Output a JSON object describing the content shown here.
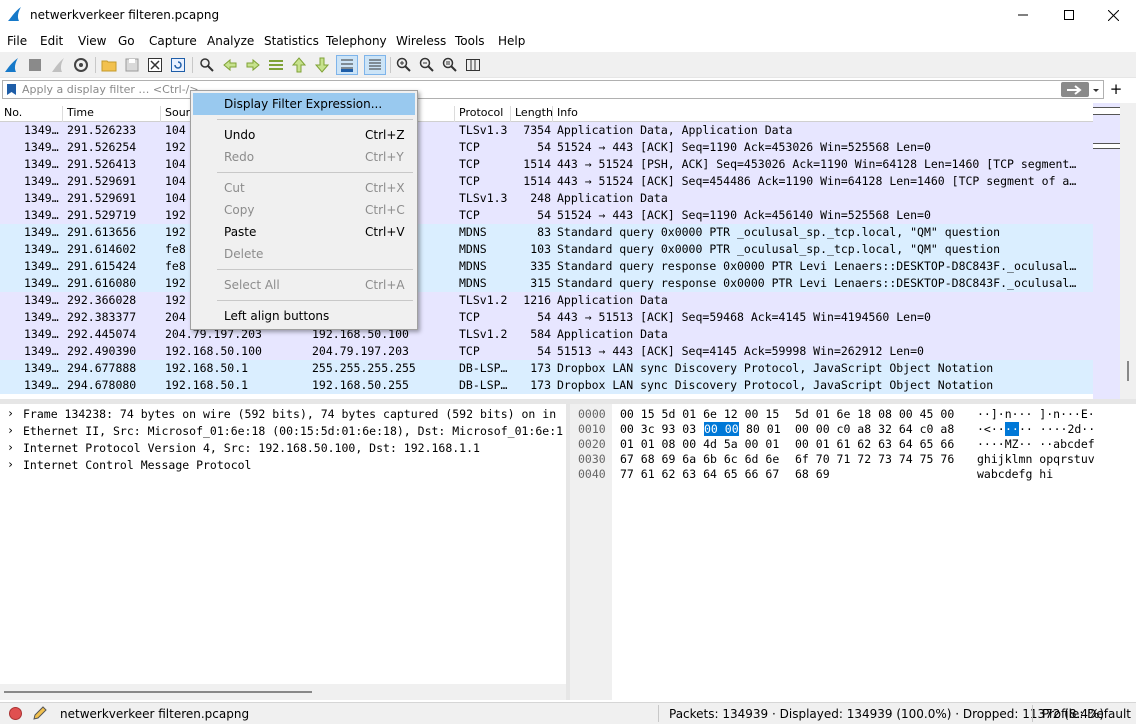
{
  "window": {
    "title": "netwerkverkeer filteren.pcapng"
  },
  "menu": [
    "File",
    "Edit",
    "View",
    "Go",
    "Capture",
    "Analyze",
    "Statistics",
    "Telephony",
    "Wireless",
    "Tools",
    "Help"
  ],
  "filter": {
    "placeholder": "Apply a display filter … <Ctrl-/>"
  },
  "columns": [
    "No.",
    "Time",
    "Sour",
    "Protocol",
    "Length",
    "Info"
  ],
  "packets": [
    {
      "no": "1349…",
      "time": "291.526233",
      "src": "104",
      "dst": "",
      "proto": "TLSv1.3",
      "len": "7354",
      "info": "Application Data, Application Data",
      "bg": "#e7e6ff"
    },
    {
      "no": "1349…",
      "time": "291.526254",
      "src": "192",
      "dst": "",
      "proto": "TCP",
      "len": "54",
      "info": "51524 → 443 [ACK] Seq=1190 Ack=453026 Win=525568 Len=0",
      "bg": "#e7e6ff"
    },
    {
      "no": "1349…",
      "time": "291.526413",
      "src": "104",
      "dst": "",
      "proto": "TCP",
      "len": "1514",
      "info": "443 → 51524 [PSH, ACK] Seq=453026 Ack=1190 Win=64128 Len=1460 [TCP segment…",
      "bg": "#e7e6ff"
    },
    {
      "no": "1349…",
      "time": "291.529691",
      "src": "104",
      "dst": "",
      "proto": "TCP",
      "len": "1514",
      "info": "443 → 51524 [ACK] Seq=454486 Ack=1190 Win=64128 Len=1460 [TCP segment of a…",
      "bg": "#e7e6ff"
    },
    {
      "no": "1349…",
      "time": "291.529691",
      "src": "104",
      "dst": "",
      "proto": "TLSv1.3",
      "len": "248",
      "info": "Application Data",
      "bg": "#e7e6ff"
    },
    {
      "no": "1349…",
      "time": "291.529719",
      "src": "192",
      "dst": "",
      "proto": "TCP",
      "len": "54",
      "info": "51524 → 443 [ACK] Seq=1190 Ack=456140 Win=525568 Len=0",
      "bg": "#e7e6ff"
    },
    {
      "no": "1349…",
      "time": "291.613656",
      "src": "192",
      "dst": "",
      "proto": "MDNS",
      "len": "83",
      "info": "Standard query 0x0000 PTR _oculusal_sp._tcp.local, \"QM\" question",
      "bg": "#daeeff"
    },
    {
      "no": "1349…",
      "time": "291.614602",
      "src": "fe8",
      "dst": "",
      "proto": "MDNS",
      "len": "103",
      "info": "Standard query 0x0000 PTR _oculusal_sp._tcp.local, \"QM\" question",
      "bg": "#daeeff"
    },
    {
      "no": "1349…",
      "time": "291.615424",
      "src": "fe8",
      "dst": "",
      "proto": "MDNS",
      "len": "335",
      "info": "Standard query response 0x0000 PTR Levi Lenaers::DESKTOP-D8C843F._oculusal…",
      "bg": "#daeeff"
    },
    {
      "no": "1349…",
      "time": "291.616080",
      "src": "192",
      "dst": "",
      "proto": "MDNS",
      "len": "315",
      "info": "Standard query response 0x0000 PTR Levi Lenaers::DESKTOP-D8C843F._oculusal…",
      "bg": "#daeeff"
    },
    {
      "no": "1349…",
      "time": "292.366028",
      "src": "192",
      "dst": "",
      "proto": "TLSv1.2",
      "len": "1216",
      "info": "Application Data",
      "bg": "#e7e6ff"
    },
    {
      "no": "1349…",
      "time": "292.383377",
      "src": "204",
      "dst": "",
      "proto": "TCP",
      "len": "54",
      "info": "443 → 51513 [ACK] Seq=59468 Ack=4145 Win=4194560 Len=0",
      "bg": "#e7e6ff"
    },
    {
      "no": "1349…",
      "time": "292.445074",
      "src": "204.79.197.203",
      "dst": "192.168.50.100",
      "proto": "TLSv1.2",
      "len": "584",
      "info": "Application Data",
      "bg": "#e7e6ff"
    },
    {
      "no": "1349…",
      "time": "292.490390",
      "src": "192.168.50.100",
      "dst": "204.79.197.203",
      "proto": "TCP",
      "len": "54",
      "info": "51513 → 443 [ACK] Seq=4145 Ack=59998 Win=262912 Len=0",
      "bg": "#e7e6ff"
    },
    {
      "no": "1349…",
      "time": "294.677888",
      "src": "192.168.50.1",
      "dst": "255.255.255.255",
      "proto": "DB-LSP…",
      "len": "173",
      "info": "Dropbox LAN sync Discovery Protocol, JavaScript Object Notation",
      "bg": "#daeeff"
    },
    {
      "no": "1349…",
      "time": "294.678080",
      "src": "192.168.50.1",
      "dst": "192.168.50.255",
      "proto": "DB-LSP…",
      "len": "173",
      "info": "Dropbox LAN sync Discovery Protocol, JavaScript Object Notation",
      "bg": "#daeeff"
    }
  ],
  "details": [
    "Frame 134238: 74 bytes on wire (592 bits), 74 bytes captured (592 bits) on in",
    "Ethernet II, Src: Microsof_01:6e:18 (00:15:5d:01:6e:18), Dst: Microsof_01:6e:1",
    "Internet Protocol Version 4, Src: 192.168.50.100, Dst: 192.168.1.1",
    "Internet Control Message Protocol"
  ],
  "bytes": [
    {
      "off": "0000",
      "hex1": "00 15 5d 01 6e 12 00 15",
      "hex2": "5d 01 6e 18 08 00 45 00",
      "ascii": "··]·n··· ]·n···E·"
    },
    {
      "off": "0010",
      "hex1": "00 3c 93 03",
      "sel": "00 00",
      "hex1b": "80 01",
      "hex2": "00 00 c0 a8 32 64 c0 a8",
      "ascii_pre": "·<··",
      "ascii_sel": "··",
      "ascii_post": "·· ····2d··"
    },
    {
      "off": "0020",
      "hex1": "01 01 08 00 4d 5a 00 01",
      "hex2": "00 01 61 62 63 64 65 66",
      "ascii": "····MZ·· ··abcdef"
    },
    {
      "off": "0030",
      "hex1": "67 68 69 6a 6b 6c 6d 6e",
      "hex2": "6f 70 71 72 73 74 75 76",
      "ascii": "ghijklmn opqrstuv"
    },
    {
      "off": "0040",
      "hex1": "77 61 62 63 64 65 66 67",
      "hex2": "68 69",
      "ascii": "wabcdefg hi"
    }
  ],
  "context_menu": [
    {
      "label": "Display Filter Expression...",
      "shortcut": "",
      "enabled": true,
      "highlight": true
    },
    {
      "sep": true
    },
    {
      "label": "Undo",
      "shortcut": "Ctrl+Z",
      "enabled": true
    },
    {
      "label": "Redo",
      "shortcut": "Ctrl+Y",
      "enabled": false
    },
    {
      "sep": true
    },
    {
      "label": "Cut",
      "shortcut": "Ctrl+X",
      "enabled": false
    },
    {
      "label": "Copy",
      "shortcut": "Ctrl+C",
      "enabled": false
    },
    {
      "label": "Paste",
      "shortcut": "Ctrl+V",
      "enabled": true
    },
    {
      "label": "Delete",
      "shortcut": "",
      "enabled": false
    },
    {
      "sep": true
    },
    {
      "label": "Select All",
      "shortcut": "Ctrl+A",
      "enabled": false
    },
    {
      "sep": true
    },
    {
      "label": "Left align buttons",
      "shortcut": "",
      "enabled": true
    }
  ],
  "status": {
    "file": "netwerkverkeer filteren.pcapng",
    "stats": "Packets: 134939 · Displayed: 134939 (100.0%) · Dropped: 11372 (8.4%)",
    "profile": "Profile: Default"
  },
  "colors": {
    "highlight": "#99c9ef",
    "accent": "#0078d7",
    "tcp": "#e7e6ff",
    "udp": "#daeeff"
  }
}
